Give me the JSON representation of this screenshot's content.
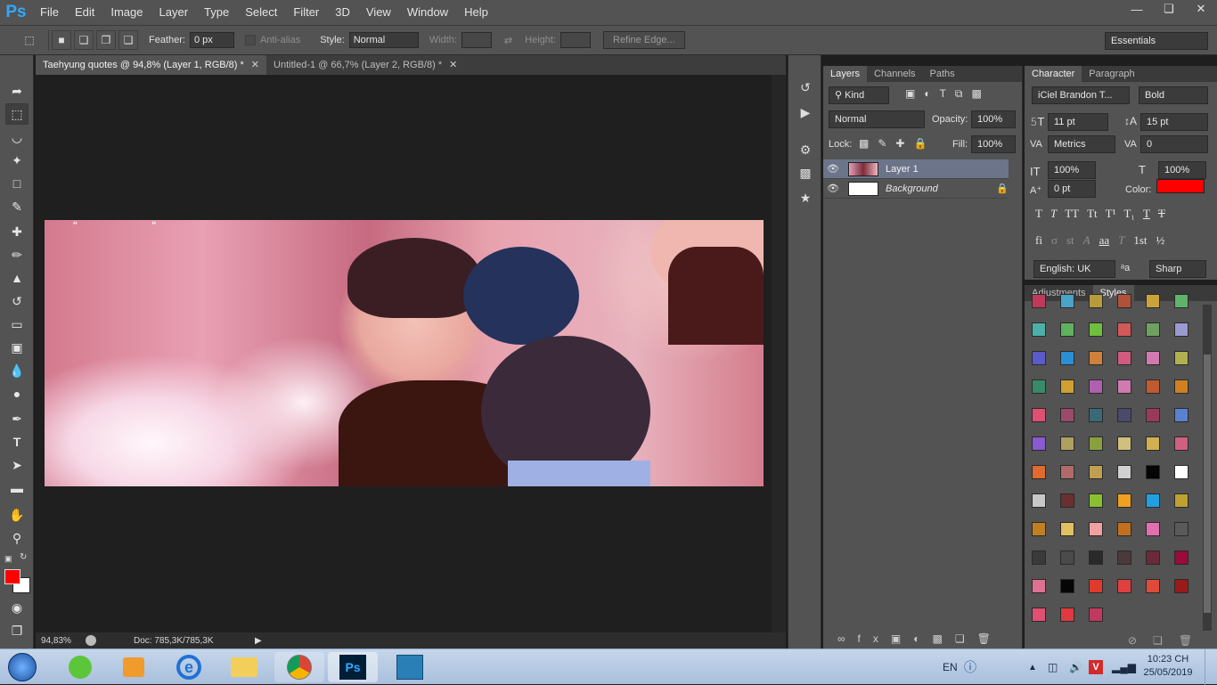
{
  "app": {
    "logo": "Ps"
  },
  "menu": [
    "File",
    "Edit",
    "Image",
    "Layer",
    "Type",
    "Select",
    "Filter",
    "3D",
    "View",
    "Window",
    "Help"
  ],
  "window_buttons": [
    "minimize-icon",
    "restore-icon",
    "close-icon"
  ],
  "options": {
    "feather_label": "Feather:",
    "feather_value": "0 px",
    "antialias_label": "Anti-alias",
    "style_label": "Style:",
    "style_value": "Normal",
    "width_label": "Width:",
    "height_label": "Height:",
    "refine_edge": "Refine Edge...",
    "workspace": "Essentials"
  },
  "tabs": [
    {
      "label": "Taehyung quotes @ 94,8% (Layer 1, RGB/8) *",
      "active": true
    },
    {
      "label": "Untitled-1 @ 66,7% (Layer 2, RGB/8) *",
      "active": false
    }
  ],
  "status": {
    "zoom": "94,83%",
    "doc": "Doc: 785,3K/785,3K"
  },
  "image_text": "“  “",
  "layers": {
    "tabs": [
      "Layers",
      "Channels",
      "Paths"
    ],
    "filter": "Kind",
    "blend": "Normal",
    "opacity_label": "Opacity:",
    "opacity": "100%",
    "lock_label": "Lock:",
    "fill_label": "Fill:",
    "fill": "100%",
    "items": [
      {
        "name": "Layer 1",
        "selected": true
      },
      {
        "name": "Background",
        "selected": false
      }
    ]
  },
  "character": {
    "tabs": [
      "Character",
      "Paragraph"
    ],
    "font": "iCiel Brandon T...",
    "style": "Bold",
    "size": "11 pt",
    "leading": "15 pt",
    "kerning": "Metrics",
    "tracking": "0",
    "vscale": "100%",
    "hscale": "100%",
    "baseline": "0 pt",
    "color_label": "Color:",
    "color": "#ff0000",
    "language": "English: UK",
    "aa": "Sharp",
    "aa_icon": "ᵃa",
    "type_buttons": [
      "T",
      "T",
      "TT",
      "Tt",
      "T¹",
      "T₁",
      "T",
      "T"
    ],
    "opentype_buttons": [
      "fi",
      "σ",
      "st",
      "A",
      "aa",
      "T",
      "1st",
      "½"
    ]
  },
  "styles": {
    "tabs": [
      "Adjustments",
      "Styles"
    ]
  },
  "colors": {
    "foreground": "#ff0000",
    "background": "#ffffff",
    "accent": "#31a8ff"
  },
  "taskbar": {
    "lang": "EN",
    "time": "10:23 CH",
    "date": "25/05/2019"
  }
}
